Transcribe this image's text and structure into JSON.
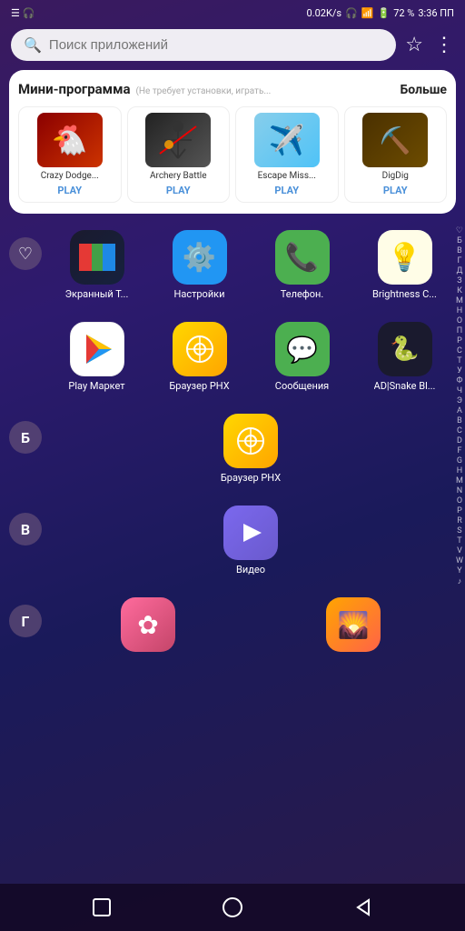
{
  "statusBar": {
    "speed": "0.02K/s",
    "battery": "72 %",
    "time": "3:36 ПП"
  },
  "search": {
    "placeholder": "Поиск приложений"
  },
  "miniSection": {
    "title": "Мини-программа",
    "subtitle": "(Не требует установки, играть...",
    "more": "Больше",
    "apps": [
      {
        "name": "Crazy Dodge...",
        "play": "PLAY",
        "icon": "🐔",
        "bg": "crazy-dodge"
      },
      {
        "name": "Archery Battle",
        "play": "PLAY",
        "icon": "🏹",
        "bg": "archery"
      },
      {
        "name": "Escape Miss...",
        "play": "PLAY",
        "icon": "✈️",
        "bg": "escape"
      },
      {
        "name": "DigDig",
        "play": "PLAY",
        "icon": "⛏️",
        "bg": "digdig"
      }
    ]
  },
  "appRows": [
    {
      "leftLabel": "♡",
      "leftType": "heart",
      "apps": [
        {
          "name": "Экранный Т...",
          "iconType": "screen",
          "iconText": "📺"
        },
        {
          "name": "Настройки",
          "iconType": "settings",
          "iconText": "⚙️"
        },
        {
          "name": "Телефон.",
          "iconType": "phone",
          "iconText": "📞"
        },
        {
          "name": "Brightness C...",
          "iconType": "brightness",
          "iconText": "💡"
        }
      ]
    },
    {
      "leftLabel": "",
      "leftType": "none",
      "apps": [
        {
          "name": "Play Маркет",
          "iconType": "playmarket",
          "iconText": "▶"
        },
        {
          "name": "Браузер PHX",
          "iconType": "browser",
          "iconText": "◎"
        },
        {
          "name": "Сообщения",
          "iconType": "messages",
          "iconText": "💬"
        },
        {
          "name": "AD|Snake Bl...",
          "iconType": "snake",
          "iconText": "🐍"
        }
      ]
    }
  ],
  "sectionB": {
    "letter": "Б",
    "apps": [
      {
        "name": "Браузер PHX",
        "iconType": "browser",
        "iconText": "◎"
      }
    ]
  },
  "sectionV": {
    "letter": "В",
    "apps": [
      {
        "name": "Видео",
        "iconType": "video",
        "iconText": "▶"
      }
    ]
  },
  "sectionG": {
    "letter": "Г",
    "apps": [
      {
        "name": "",
        "iconType": "app1",
        "iconText": "✿"
      },
      {
        "name": "",
        "iconType": "app2",
        "iconText": "🌄"
      }
    ]
  },
  "alphabetIndex": [
    "♡",
    "Б",
    "В",
    "Г",
    "Д",
    "З",
    "К",
    "М",
    "Н",
    "О",
    "П",
    "Р",
    "С",
    "Т",
    "У",
    "Ф",
    "Ч",
    "Э",
    "А",
    "B",
    "C",
    "D",
    "F",
    "G",
    "H",
    "M",
    "N",
    "O",
    "P",
    "R",
    "S",
    "T",
    "V",
    "W",
    "Y",
    "♪"
  ],
  "navBar": {
    "square": "▢",
    "circle": "○",
    "triangle": "◁"
  }
}
